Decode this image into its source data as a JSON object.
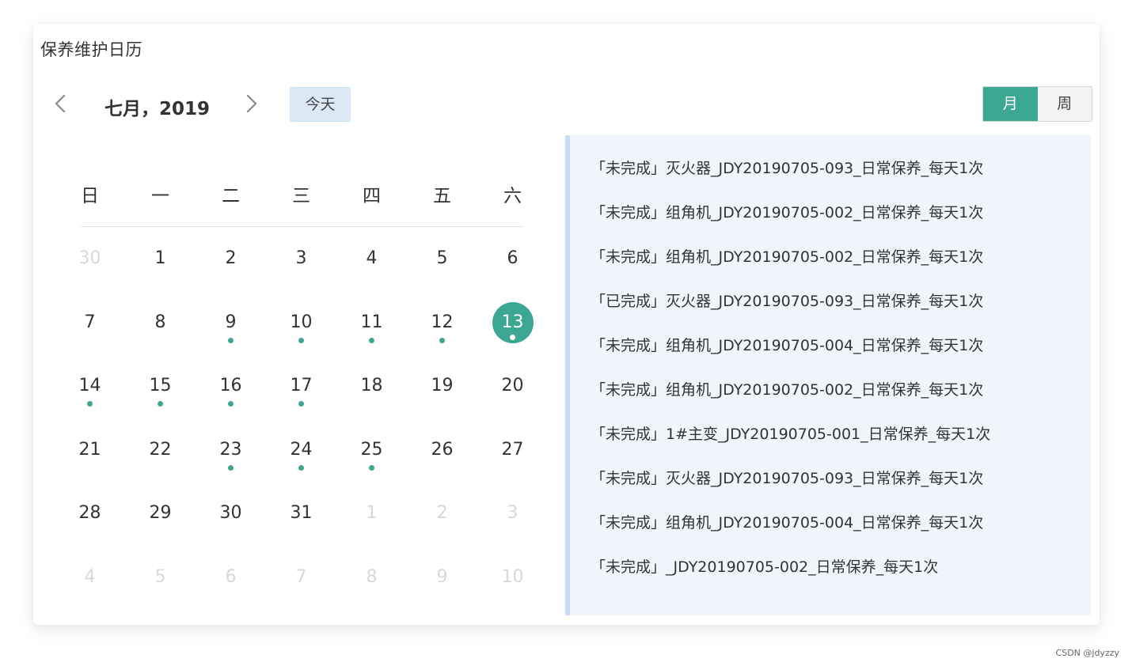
{
  "card": {
    "title": "保养维护日历"
  },
  "nav": {
    "prev_icon": "chevron-left-icon",
    "next_icon": "chevron-right-icon",
    "month_label": "七月，2019",
    "today_label": "今天"
  },
  "view_toggle": {
    "month_label": "月",
    "week_label": "周",
    "active": "month"
  },
  "calendar": {
    "weekdays": [
      "日",
      "一",
      "二",
      "三",
      "四",
      "五",
      "六"
    ],
    "days": [
      {
        "d": "30",
        "other": true
      },
      {
        "d": "1"
      },
      {
        "d": "2"
      },
      {
        "d": "3"
      },
      {
        "d": "4"
      },
      {
        "d": "5"
      },
      {
        "d": "6"
      },
      {
        "d": "7"
      },
      {
        "d": "8"
      },
      {
        "d": "9",
        "dot": true
      },
      {
        "d": "10",
        "dot": true
      },
      {
        "d": "11",
        "dot": true
      },
      {
        "d": "12",
        "dot": true
      },
      {
        "d": "13",
        "dot": true,
        "selected": true
      },
      {
        "d": "14",
        "dot": true
      },
      {
        "d": "15",
        "dot": true
      },
      {
        "d": "16",
        "dot": true
      },
      {
        "d": "17",
        "dot": true
      },
      {
        "d": "18"
      },
      {
        "d": "19"
      },
      {
        "d": "20"
      },
      {
        "d": "21"
      },
      {
        "d": "22"
      },
      {
        "d": "23",
        "dot": true
      },
      {
        "d": "24",
        "dot": true
      },
      {
        "d": "25",
        "dot": true
      },
      {
        "d": "26"
      },
      {
        "d": "27"
      },
      {
        "d": "28"
      },
      {
        "d": "29"
      },
      {
        "d": "30"
      },
      {
        "d": "31"
      },
      {
        "d": "1",
        "other": true
      },
      {
        "d": "2",
        "other": true
      },
      {
        "d": "3",
        "other": true
      },
      {
        "d": "4",
        "other": true
      },
      {
        "d": "5",
        "other": true
      },
      {
        "d": "6",
        "other": true
      },
      {
        "d": "7",
        "other": true
      },
      {
        "d": "8",
        "other": true
      },
      {
        "d": "9",
        "other": true
      },
      {
        "d": "10",
        "other": true
      }
    ]
  },
  "events": [
    "「未完成」灭火器_JDY20190705-093_日常保养_每天1次",
    "「未完成」组角机_JDY20190705-002_日常保养_每天1次",
    "「未完成」组角机_JDY20190705-002_日常保养_每天1次",
    "「已完成」灭火器_JDY20190705-093_日常保养_每天1次",
    "「未完成」组角机_JDY20190705-004_日常保养_每天1次",
    "「未完成」组角机_JDY20190705-002_日常保养_每天1次",
    "「未完成」1#主变_JDY20190705-001_日常保养_每天1次",
    "「未完成」灭火器_JDY20190705-093_日常保养_每天1次",
    "「未完成」组角机_JDY20190705-004_日常保养_每天1次",
    "「未完成」_JDY20190705-002_日常保养_每天1次"
  ],
  "colors": {
    "accent": "#3ca792",
    "today_bg": "#dbe9f6",
    "events_bg": "#f0f4fb",
    "events_border": "#c9dcf0"
  },
  "watermark": "CSDN @jdyzzy"
}
